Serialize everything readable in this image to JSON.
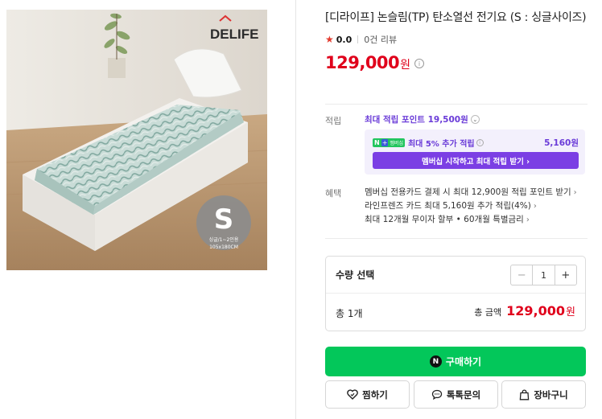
{
  "product": {
    "title": "[디라이프] 논슬림(TP) 탄소열선 전기요 (S : 싱글사이즈)",
    "brand_logo": "DELIFE",
    "size_badge": {
      "letter": "S",
      "line1": "싱글/1~2인용",
      "line2": "105x180CM"
    }
  },
  "rating": {
    "score": "0.0",
    "reviews": "0건 리뷰"
  },
  "price": {
    "amount": "129,000",
    "unit": "원"
  },
  "points": {
    "label": "적립",
    "max_points": "최대 적립 포인트 19,500원",
    "membership_text": "최대 5% 추가 적립",
    "membership_amount": "5,160원",
    "membership_button": "멤버십 시작하고 최대 적립 받기 ›",
    "badge_n": "N",
    "badge_plus": "+",
    "badge_text": "멤버십"
  },
  "benefits": {
    "label": "혜택",
    "items": [
      "멤버십 전용카드 결제 시 최대 12,900원 적립 포인트 받기",
      "라인프렌즈 카드 최대 5,160원 추가 적립(4%)",
      "최대 12개월 무이자 할부 • 60개월 특별금리"
    ]
  },
  "quantity": {
    "label": "수량 선택",
    "value": "1",
    "minus": "−",
    "plus": "+",
    "total_count": "총 1개",
    "total_label": "총 금액",
    "total_amount": "129,000",
    "total_unit": "원"
  },
  "actions": {
    "buy": "구매하기",
    "buy_icon": "N",
    "wish": "찜하기",
    "talk": "톡톡문의",
    "cart": "장바구니"
  },
  "colors": {
    "price_red": "#e0001b",
    "buy_green": "#03c75a",
    "membership_purple": "#7b3fe4"
  }
}
